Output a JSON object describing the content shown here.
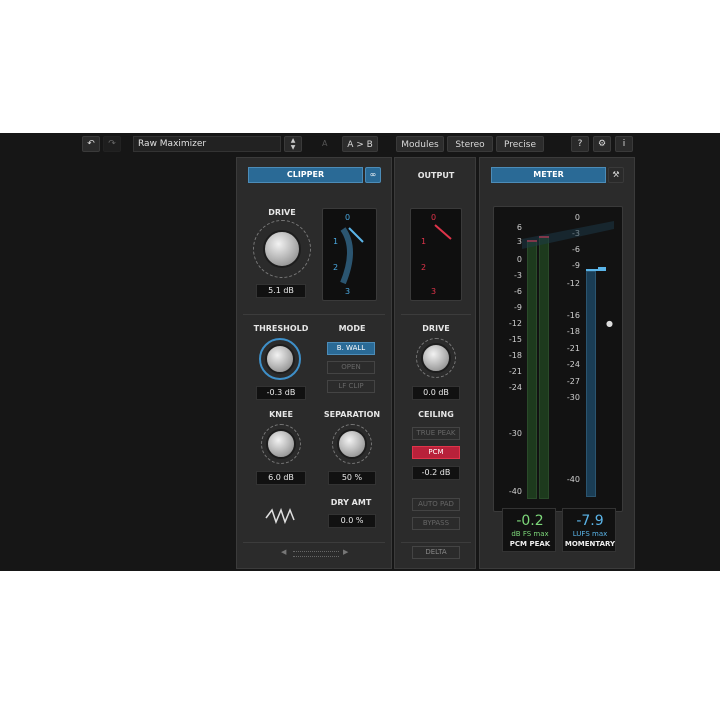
{
  "toolbar": {
    "preset_name": "Raw Maximizer",
    "ab_label": "A",
    "atob_label": "A > B",
    "modules_label": "Modules",
    "stereo_label": "Stereo",
    "precise_label": "Precise",
    "help_label": "?",
    "info_label": "i"
  },
  "clipper": {
    "header": "CLIPPER",
    "drive_label": "DRIVE",
    "drive_value": "5.1 dB",
    "scope_ticks": [
      "0",
      "1",
      "2",
      "3"
    ],
    "threshold_label": "THRESHOLD",
    "threshold_value": "-0.3 dB",
    "mode_label": "MODE",
    "modes": [
      "B. WALL",
      "OPEN",
      "LF CLIP"
    ],
    "knee_label": "KNEE",
    "knee_value": "6.0 dB",
    "separation_label": "SEPARATION",
    "separation_value": "50 %",
    "dry_amt_label": "DRY AMT",
    "dry_amt_value": "0.0 %"
  },
  "output": {
    "header": "OUTPUT",
    "scope_ticks": [
      "0",
      "1",
      "2",
      "3"
    ],
    "drive_label": "DRIVE",
    "drive_value": "0.0 dB",
    "ceiling_label": "CEILING",
    "true_peak_label": "TRUE PEAK",
    "pcm_label": "PCM",
    "ceiling_value": "-0.2 dB",
    "auto_pad_label": "AUTO PAD",
    "bypass_label": "BYPASS",
    "delta_label": "DELTA"
  },
  "meter": {
    "header": "METER",
    "left_scale": [
      "6",
      "3",
      "0",
      "-3",
      "-6",
      "-9",
      "-12",
      "-15",
      "-18",
      "-21",
      "-24",
      "-30",
      "-40"
    ],
    "right_scale": [
      "0",
      "-3",
      "-6",
      "-9",
      "-12",
      "-16",
      "-18",
      "-21",
      "-24",
      "-27",
      "-30",
      "-40"
    ],
    "peak_value": "-0.2",
    "peak_unit": "dB FS max",
    "peak_label": "PCM PEAK",
    "lufs_value": "-7.9",
    "lufs_unit": "LUFS max",
    "lufs_label": "MOMENTARY",
    "accent_peak": "#7dd87a",
    "accent_lufs": "#5ab4e8"
  }
}
